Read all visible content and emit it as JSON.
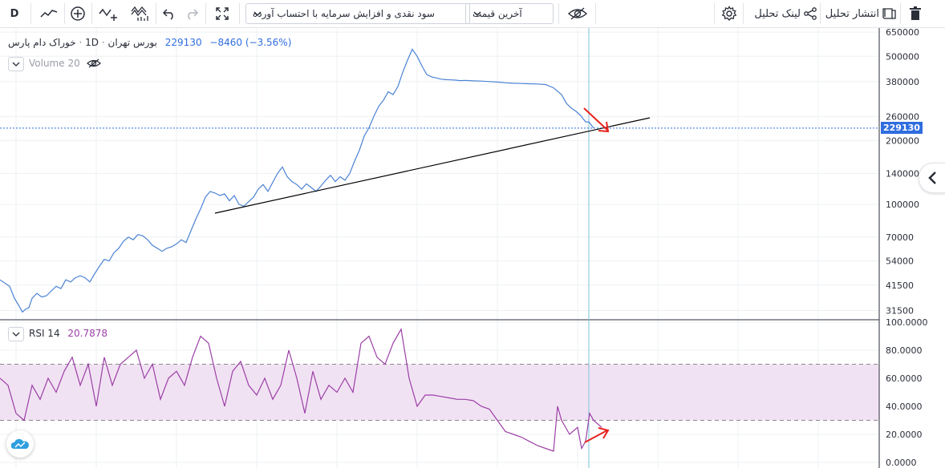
{
  "toolbar": {
    "interval": "D",
    "delete_icon": "trash-icon",
    "publish_label": "انتشار تحلیل",
    "share_label": "لینک تحلیل",
    "price_type": "آخرین قیمت",
    "adjustment": "سود نقدی و افزایش سرمایه با احتساب آورده"
  },
  "legend": {
    "symbol": "خوراک دام پارس",
    "exchange": "بورس تهران",
    "interval": "1D",
    "last": "229130",
    "change": "−8460",
    "change_pct": "(−3.56%)",
    "volume": "Volume 20",
    "rsi_name": "RSI 14",
    "rsi_value": "20.7878"
  },
  "colors": {
    "price_line": "#4a82d4",
    "rsi_line": "#9b3fa6",
    "rsi_band": "#f1e2f3",
    "trend_line": "#000000",
    "arrow": "#e8231f",
    "accent": "#2f6ddf",
    "crosshair": "#7ec3d8"
  },
  "chart_data": [
    {
      "type": "line",
      "name": "price",
      "scale": "log",
      "y_ticks": [
        650000,
        500000,
        380000,
        260000,
        200000,
        140000,
        100000,
        70000,
        54000,
        41500,
        31500
      ],
      "last_price": 229130,
      "x": [
        0,
        12,
        18,
        24,
        28,
        32,
        36,
        40,
        46,
        52,
        58,
        64,
        70,
        76,
        82,
        88,
        94,
        100,
        106,
        112,
        118,
        124,
        130,
        136,
        142,
        148,
        154,
        160,
        166,
        172,
        178,
        184,
        190,
        196,
        202,
        208,
        214,
        220,
        226,
        232,
        238,
        244,
        250,
        256,
        262,
        268,
        274,
        280,
        286,
        292,
        298,
        304,
        310,
        316,
        322,
        328,
        334,
        340,
        346,
        352,
        358,
        364,
        370,
        376,
        382,
        388,
        394,
        400,
        406,
        412,
        418,
        424,
        430,
        436,
        442,
        448,
        454,
        460,
        466,
        472,
        478,
        484,
        490,
        496,
        502,
        508,
        514,
        520,
        526,
        532,
        538,
        544,
        550,
        556,
        562,
        568,
        574,
        580,
        590,
        600,
        610,
        620,
        630,
        640,
        650,
        660,
        670,
        680,
        690,
        700,
        706,
        712,
        718,
        724,
        730,
        734,
        740
      ],
      "y": [
        44000,
        41000,
        36000,
        33000,
        31000,
        32000,
        32500,
        36000,
        38000,
        36500,
        37000,
        39000,
        41000,
        40000,
        44000,
        43000,
        45000,
        46000,
        45000,
        43000,
        47000,
        51000,
        55000,
        54000,
        59000,
        62000,
        67000,
        70000,
        68000,
        72000,
        71000,
        68000,
        64000,
        62000,
        60000,
        62000,
        63000,
        65000,
        68000,
        66000,
        75000,
        85000,
        95000,
        108000,
        115000,
        113000,
        110000,
        112000,
        104000,
        110000,
        100000,
        98000,
        103000,
        108000,
        118000,
        124000,
        115000,
        127000,
        140000,
        150000,
        135000,
        128000,
        124000,
        118000,
        125000,
        120000,
        115000,
        122000,
        130000,
        137000,
        128000,
        135000,
        130000,
        140000,
        160000,
        180000,
        210000,
        230000,
        260000,
        290000,
        310000,
        340000,
        330000,
        360000,
        420000,
        480000,
        540000,
        500000,
        450000,
        410000,
        400000,
        395000,
        390000,
        388000,
        387000,
        386000,
        384000,
        385000,
        383000,
        382000,
        380000,
        378000,
        375000,
        373000,
        372000,
        371000,
        370000,
        368000,
        355000,
        330000,
        300000,
        285000,
        275000,
        262000,
        245000,
        245000,
        229130
      ]
    },
    {
      "type": "line",
      "name": "RSI 14",
      "ylim": [
        0,
        100
      ],
      "y_ticks": [
        100,
        80,
        60,
        40,
        20,
        0
      ],
      "band": [
        30,
        70
      ],
      "last_value": 20.7878,
      "x": [
        0,
        10,
        20,
        30,
        40,
        50,
        60,
        70,
        80,
        90,
        100,
        110,
        120,
        130,
        140,
        150,
        160,
        170,
        180,
        190,
        200,
        210,
        220,
        230,
        240,
        250,
        260,
        270,
        280,
        290,
        300,
        310,
        320,
        330,
        340,
        350,
        360,
        370,
        380,
        390,
        400,
        410,
        420,
        430,
        440,
        450,
        460,
        470,
        480,
        490,
        500,
        510,
        520,
        530,
        540,
        550,
        560,
        570,
        580,
        590,
        600,
        610,
        620,
        630,
        640,
        650,
        660,
        670,
        680,
        690,
        695,
        700,
        710,
        720,
        725,
        730,
        735,
        740,
        750
      ],
      "y": [
        60,
        55,
        35,
        30,
        55,
        45,
        60,
        50,
        65,
        75,
        55,
        70,
        40,
        75,
        55,
        70,
        75,
        80,
        60,
        70,
        45,
        60,
        65,
        55,
        75,
        90,
        85,
        60,
        40,
        65,
        72,
        55,
        48,
        60,
        45,
        55,
        80,
        60,
        35,
        65,
        45,
        55,
        50,
        60,
        50,
        85,
        90,
        75,
        70,
        85,
        95,
        60,
        40,
        48,
        48,
        47,
        46,
        45,
        45,
        44,
        40,
        38,
        30,
        22,
        20,
        18,
        15,
        12,
        10,
        8,
        40,
        30,
        20,
        25,
        10,
        15,
        35,
        30,
        25
      ]
    }
  ]
}
